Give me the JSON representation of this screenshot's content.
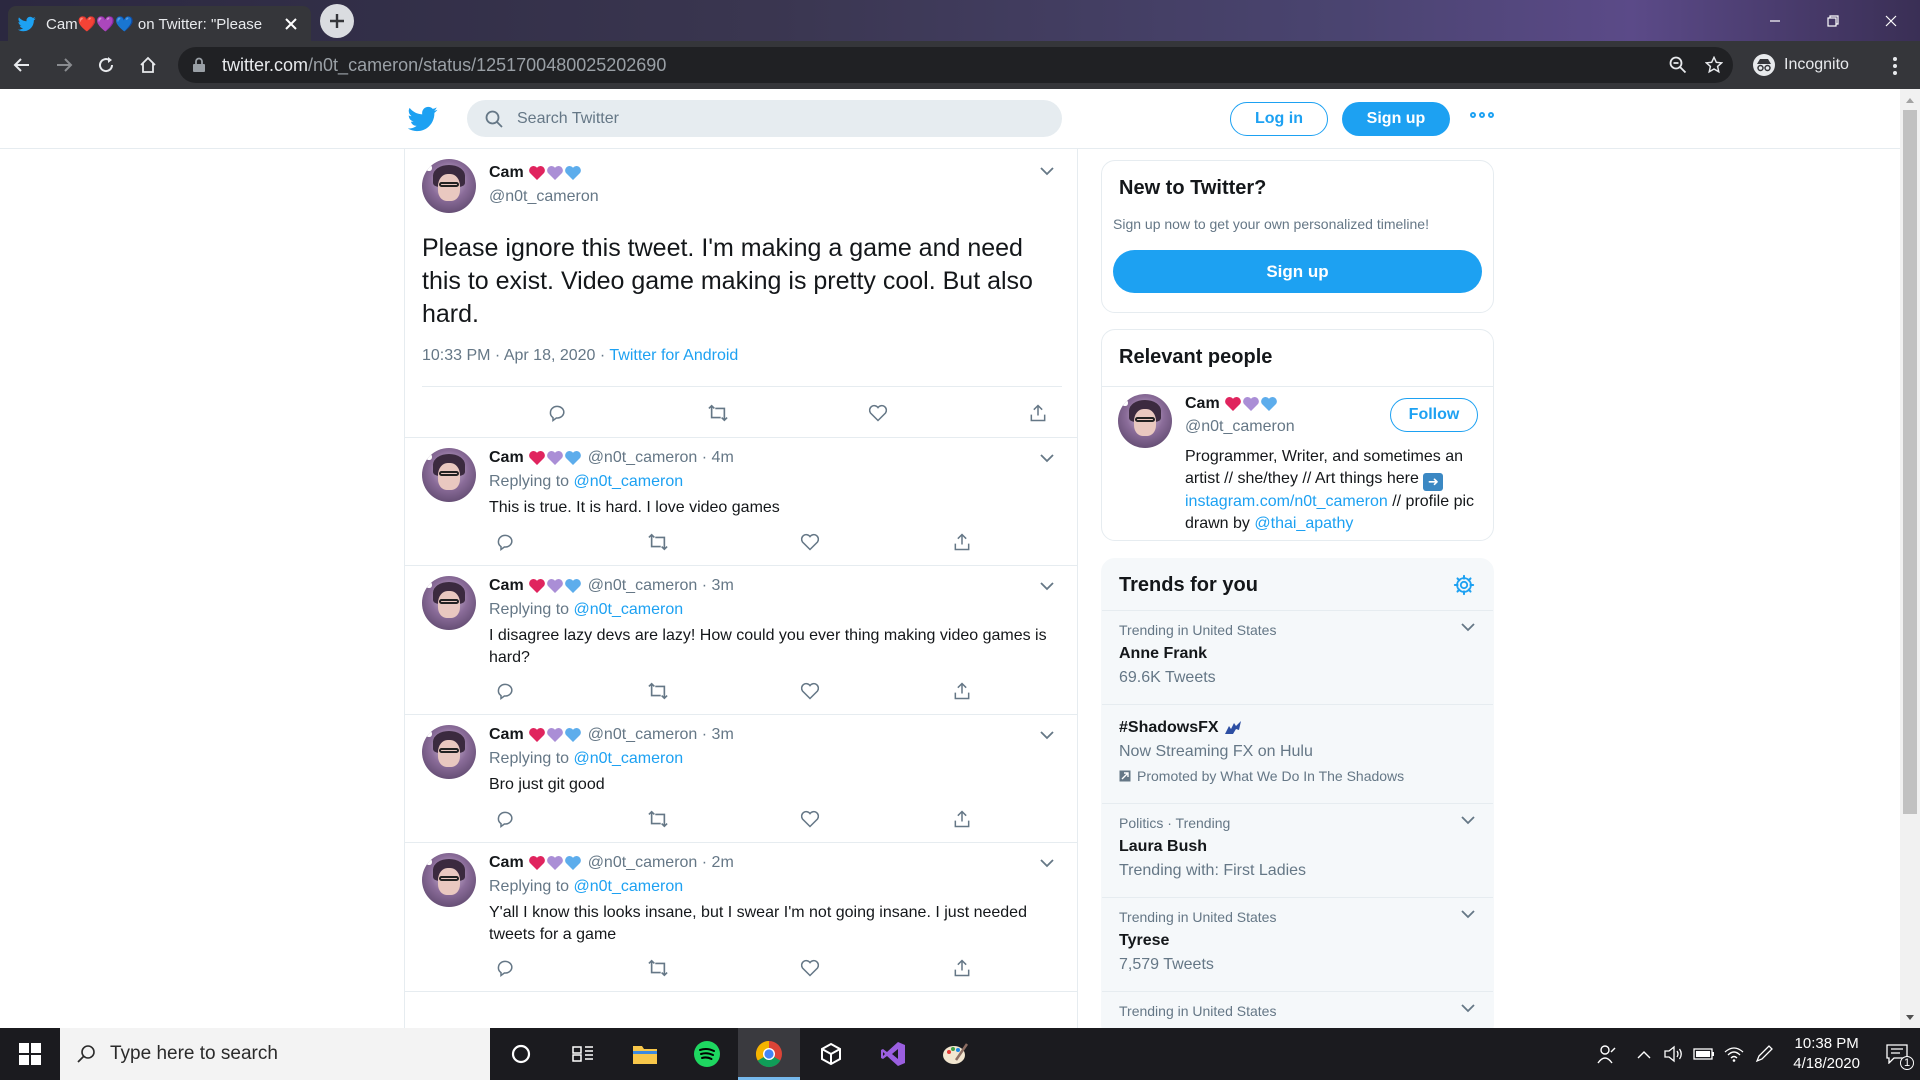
{
  "browser": {
    "tab_title": "Cam❤️💜💙 on Twitter: \"Please",
    "url_host": "twitter.com",
    "url_path": "/n0t_cameron/status/1251700480025202690",
    "incognito_label": "Incognito"
  },
  "header": {
    "search_placeholder": "Search Twitter",
    "login_label": "Log in",
    "signup_label": "Sign up"
  },
  "main_tweet": {
    "name": "Cam",
    "handle": "@n0t_cameron",
    "text": "Please ignore this tweet. I'm making a game and need this to exist. Video game making is pretty cool. But also hard.",
    "time": "10:33 PM · Apr 18, 2020 · ",
    "source": "Twitter for Android"
  },
  "replies": [
    {
      "name": "Cam",
      "handle": "@n0t_cameron · 4m",
      "replying_prefix": "Replying to ",
      "replying_to": "@n0t_cameron",
      "text": "This is true. It is hard. I love video games"
    },
    {
      "name": "Cam",
      "handle": "@n0t_cameron · 3m",
      "replying_prefix": "Replying to ",
      "replying_to": "@n0t_cameron",
      "text": "I disagree lazy devs are lazy! How could you ever thing making video games is hard?"
    },
    {
      "name": "Cam",
      "handle": "@n0t_cameron · 3m",
      "replying_prefix": "Replying to ",
      "replying_to": "@n0t_cameron",
      "text": "Bro just git good"
    },
    {
      "name": "Cam",
      "handle": "@n0t_cameron · 2m",
      "replying_prefix": "Replying to ",
      "replying_to": "@n0t_cameron",
      "text": "Y'all I know this looks insane, but I swear I'm not going insane. I just needed tweets for a game"
    }
  ],
  "new_to_twitter": {
    "title": "New to Twitter?",
    "subtitle": "Sign up now to get your own personalized timeline!",
    "button": "Sign up"
  },
  "relevant_people": {
    "title": "Relevant people",
    "name": "Cam",
    "handle": "@n0t_cameron",
    "follow_label": "Follow",
    "bio_1": "Programmer, Writer, and sometimes an artist // she/they // Art things here ",
    "bio_link": "instagram.com/n0t_cameron",
    "bio_2": " // profile pic drawn by ",
    "bio_mention": "@thai_apathy"
  },
  "trends": {
    "title": "Trends for you",
    "items": [
      {
        "context": "Trending in United States",
        "name": "Anne Frank",
        "sub": "69.6K Tweets"
      },
      {
        "name": "#ShadowsFX",
        "sub": "Now Streaming FX on Hulu",
        "promo": "Promoted by What We Do In The Shadows"
      },
      {
        "context": "Politics · Trending",
        "name": "Laura Bush",
        "sub": "Trending with: First Ladies"
      },
      {
        "context": "Trending in United States",
        "name": "Tyrese",
        "sub": "7,579 Tweets"
      },
      {
        "context": "Trending in United States"
      }
    ]
  },
  "taskbar": {
    "search_placeholder": "Type here to search",
    "time": "10:38 PM",
    "date": "4/18/2020",
    "notification_count": "1"
  },
  "colors": {
    "twitter_blue": "#1da1f2",
    "secondary_text": "#657786",
    "heart_red": "#e0245e",
    "heart_purple": "#aa8ed6",
    "heart_blue": "#5dadec"
  }
}
